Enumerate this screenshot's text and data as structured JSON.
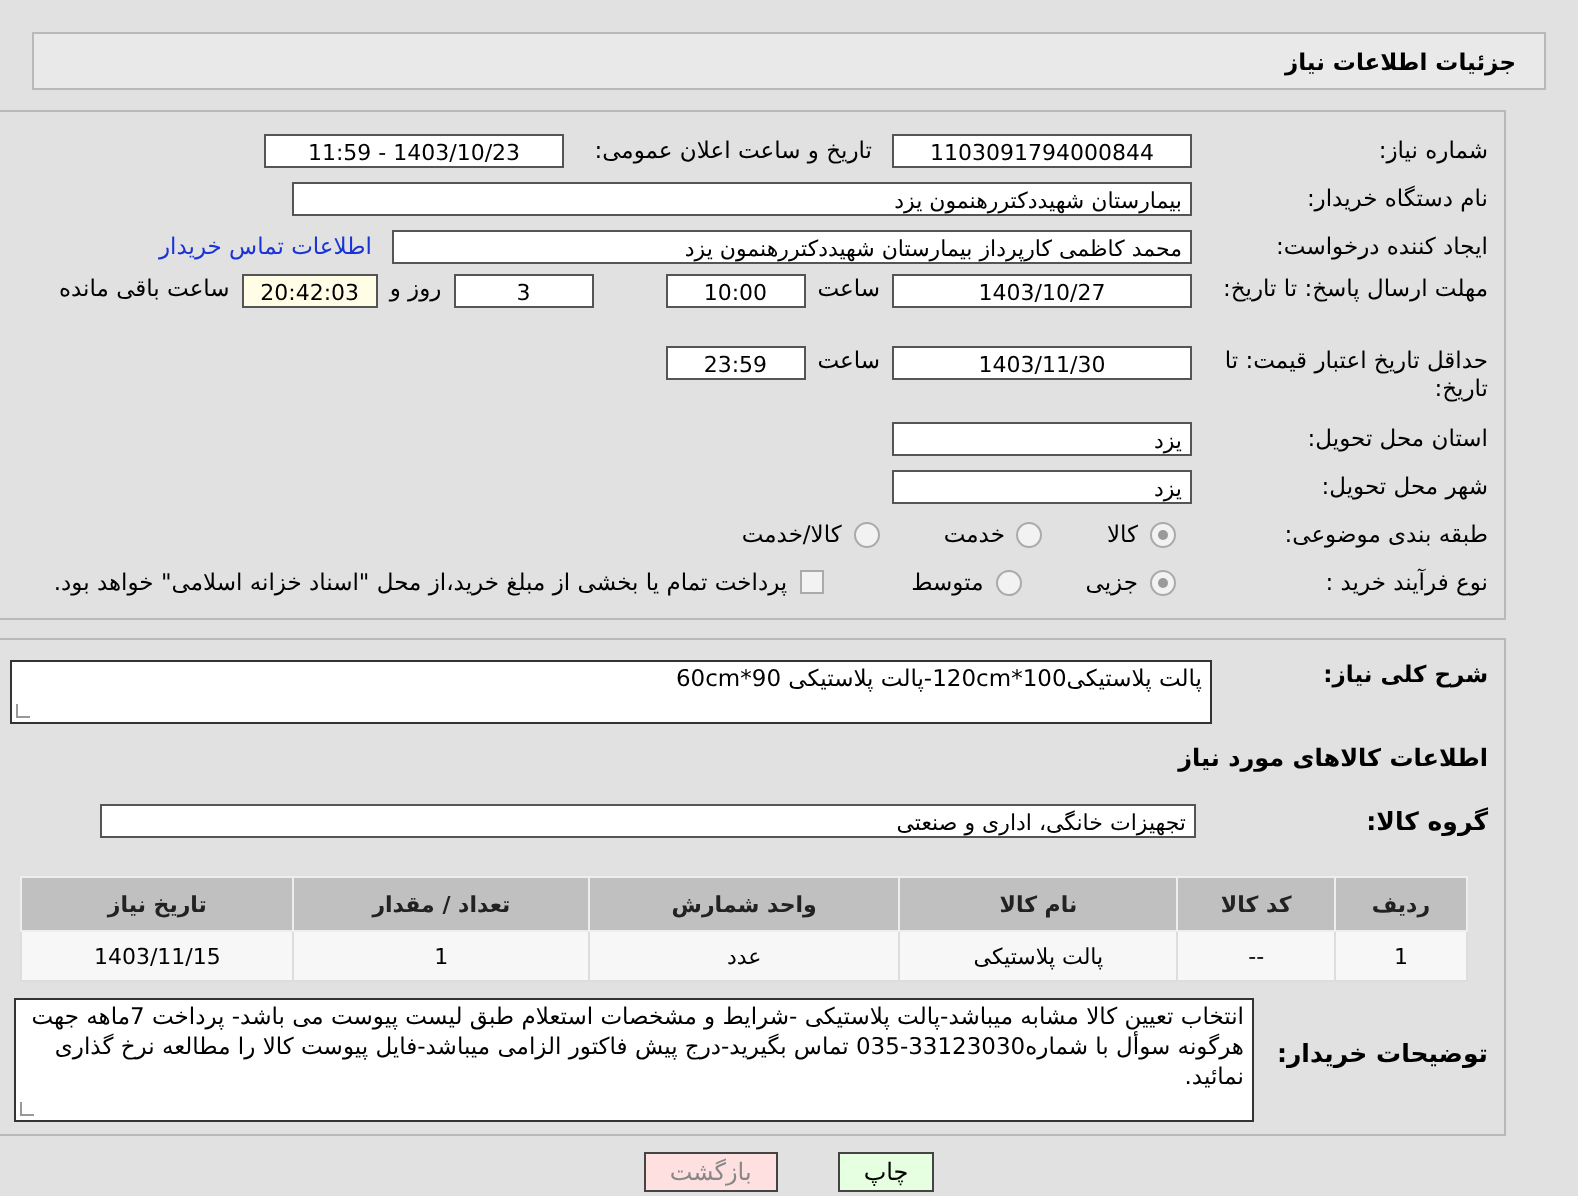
{
  "header": {
    "title": "جزئیات اطلاعات نیاز"
  },
  "need_number": {
    "label": "شماره نیاز:",
    "value": "1103091794000844"
  },
  "announce": {
    "label": "تاریخ و ساعت اعلان عمومی:",
    "value": "1403/10/23 - 11:59"
  },
  "buyer_org": {
    "label": "نام دستگاه خریدار:",
    "value": "بیمارستان شهیددکتررهنمون یزد"
  },
  "creator": {
    "label": "ایجاد کننده درخواست:",
    "value": "محمد کاظمی کارپرداز بیمارستان شهیددکتررهنمون یزد",
    "link": "اطلاعات تماس خریدار"
  },
  "deadline": {
    "label": "مهلت ارسال پاسخ: تا تاریخ:",
    "date": "1403/10/27",
    "time_label": "ساعت",
    "time": "10:00",
    "days": "3",
    "days_label": "روز و",
    "remaining": "20:42:03",
    "remaining_label": "ساعت باقی مانده"
  },
  "validity": {
    "label": "حداقل تاریخ اعتبار قیمت: تا تاریخ:",
    "date": "1403/11/30",
    "time_label": "ساعت",
    "time": "23:59"
  },
  "province": {
    "label": "استان محل تحویل:",
    "value": "یزد"
  },
  "city": {
    "label": "شهر محل تحویل:",
    "value": "یزد"
  },
  "category": {
    "label": "طبقه بندی موضوعی:",
    "options": [
      {
        "label": "کالا",
        "selected": true
      },
      {
        "label": "خدمت",
        "selected": false
      },
      {
        "label": "کالا/خدمت",
        "selected": false
      }
    ]
  },
  "process": {
    "label": "نوع فرآیند خرید :",
    "options": [
      {
        "label": "جزیی",
        "selected": true
      },
      {
        "label": "متوسط",
        "selected": false
      }
    ],
    "treasury": {
      "label": "پرداخت تمام یا بخشی از مبلغ خرید،از محل \"اسناد خزانه اسلامی\" خواهد بود.",
      "checked": false
    }
  },
  "description": {
    "label": "شرح کلی نیاز:",
    "value": "پالت پلاستیکی100*120cm-پالت پلاستیکی 90*60cm"
  },
  "goods_heading": "اطلاعات کالاهای مورد نیاز",
  "goods_group": {
    "label": "گروه کالا:",
    "value": "تجهیزات خانگی، اداری و صنعتی"
  },
  "table": {
    "columns": [
      "ردیف",
      "کد کالا",
      "نام کالا",
      "واحد شمارش",
      "تعداد / مقدار",
      "تاریخ نیاز"
    ],
    "rows": [
      [
        "1",
        "--",
        "پالت پلاستیکی",
        "عدد",
        "1",
        "1403/11/15"
      ]
    ]
  },
  "buyer_notes": {
    "label": "توضیحات خریدار:",
    "value": "انتخاب تعیین کالا مشابه میباشد-پالت پلاستیکی -شرایط و مشخصات استعلام طبق لیست پیوست می باشد- پرداخت 7ماهه جهت هرگونه سوأل با شماره33123030-035 تماس بگیرید-درج پیش فاکتور الزامی میباشد-فایل پیوست کالا را مطالعه نرخ گذاری نمائید."
  },
  "buttons": [
    {
      "label": "چاپ",
      "kind": "print"
    },
    {
      "label": "بازگشت",
      "kind": "back"
    }
  ]
}
